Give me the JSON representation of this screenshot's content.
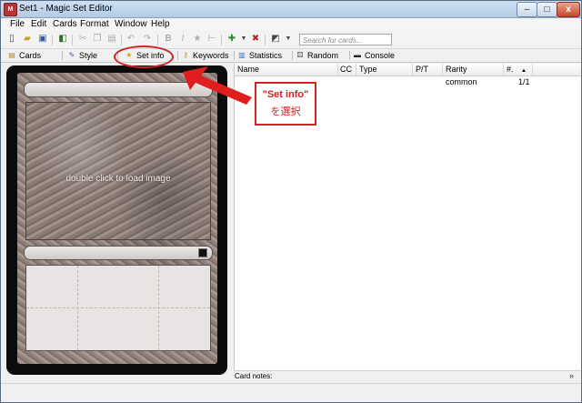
{
  "window": {
    "title": "Set1 - Magic Set Editor",
    "app_icon_glyph": "M",
    "controls": {
      "minimize": "–",
      "maximize": "□",
      "close": "x"
    }
  },
  "menu": {
    "file": "File",
    "edit": "Edit",
    "cards": "Cards",
    "format": "Format",
    "window": "Window",
    "help": "Help"
  },
  "toolbar": {
    "search_placeholder": "Search for cards...",
    "icons": [
      "new-icon",
      "open-icon",
      "save-icon",
      "export-icon",
      "cut-icon",
      "copy-icon",
      "paste-icon",
      "undo-icon",
      "redo-icon",
      "bold-icon",
      "italic-icon",
      "symbol-icon",
      "reminder-icon",
      "add-card-icon",
      "remove-card-icon",
      "rotate-icon"
    ]
  },
  "tabs": {
    "cards": "Cards",
    "style": "Style",
    "set_info": "Set info",
    "keywords": "Keywords",
    "statistics": "Statistics",
    "random": "Random",
    "console": "Console"
  },
  "card": {
    "art_placeholder": "double click to load image"
  },
  "list": {
    "columns": {
      "name": "Name",
      "cc": "CC",
      "type": "Type",
      "pt": "P/T",
      "rarity": "Rarity",
      "num": "#."
    },
    "sort_indicator": "▲",
    "rows": [
      {
        "name": "",
        "cc": "",
        "type": "",
        "pt": "",
        "rarity": "common",
        "num": "1/1"
      }
    ]
  },
  "notes": {
    "label": "Card notes:",
    "toggle": "»"
  },
  "annotation": {
    "line1": "\"Set info\"",
    "line2": "を選択",
    "color": "#d22222"
  },
  "colors": {
    "accent": "#d22222",
    "window_bg": "#f0f0f0",
    "card_frame": "#0c0c0c"
  }
}
